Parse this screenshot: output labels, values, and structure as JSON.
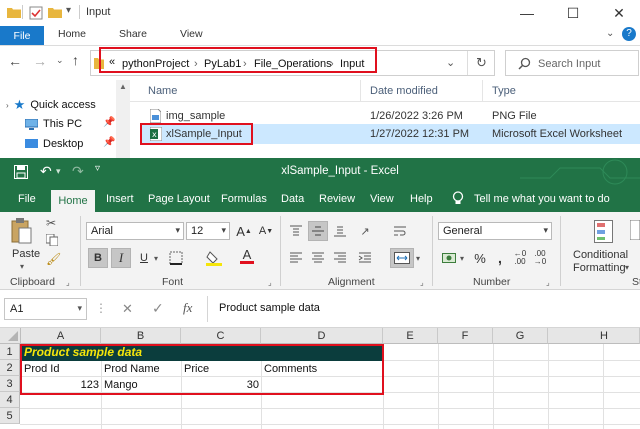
{
  "explorer": {
    "window_title": "Input",
    "tabs": {
      "file": "File",
      "home": "Home",
      "share": "Share",
      "view": "View"
    },
    "breadcrumb": {
      "prefix": "«",
      "items": [
        "pythonProject",
        "PyLab1",
        "File_Operations",
        "Input"
      ],
      "separator": "›"
    },
    "search_placeholder": "Search Input",
    "nav": {
      "quick_access": "Quick access",
      "this_pc": "This PC",
      "desktop": "Desktop"
    },
    "columns": {
      "name": "Name",
      "date": "Date modified",
      "type": "Type"
    },
    "files": [
      {
        "name": "img_sample",
        "date": "1/26/2022 3:26 PM",
        "type": "PNG File",
        "icon": "png-file-icon"
      },
      {
        "name": "xlSample_Input",
        "date": "1/27/2022 12:31 PM",
        "type": "Microsoft Excel Worksheet",
        "icon": "excel-file-icon"
      }
    ]
  },
  "excel": {
    "window_title": "xlSample_Input  -  Excel",
    "accent": "#217346",
    "tabs": {
      "file": "File",
      "home": "Home",
      "insert": "Insert",
      "page_layout": "Page Layout",
      "formulas": "Formulas",
      "data": "Data",
      "review": "Review",
      "view": "View",
      "help": "Help"
    },
    "tell_me": "Tell me what you want to do",
    "ribbon": {
      "paste": "Paste",
      "clipboard": "Clipboard",
      "font_name": "Arial",
      "font_size": "12",
      "font_group": "Font",
      "alignment_group": "Alignment",
      "number_format": "General",
      "number_group": "Number",
      "percent": "%",
      "comma": ",",
      "conditional_formatting_1": "Conditional",
      "conditional_formatting_2": "Formatting",
      "styles_group_partial": "St",
      "bold": "B",
      "italic": "I",
      "underline": "U"
    },
    "formula_bar": {
      "name_box": "A1",
      "fx": "fx",
      "value": "Product sample data"
    },
    "columns": [
      "A",
      "B",
      "C",
      "D",
      "E",
      "F",
      "G",
      "H"
    ],
    "rows": [
      "1",
      "2",
      "3",
      "4",
      "5"
    ],
    "cells": {
      "A1": "Product sample data",
      "A2": "Prod Id",
      "B2": "Prod Name",
      "C2": "Price",
      "D2": "Comments",
      "A3": "123",
      "B3": "Mango",
      "C3": "30"
    },
    "header_band_color": "#0b3d3d",
    "title_text_color": "#f5e50a"
  },
  "highlight_color": "#e0101e"
}
